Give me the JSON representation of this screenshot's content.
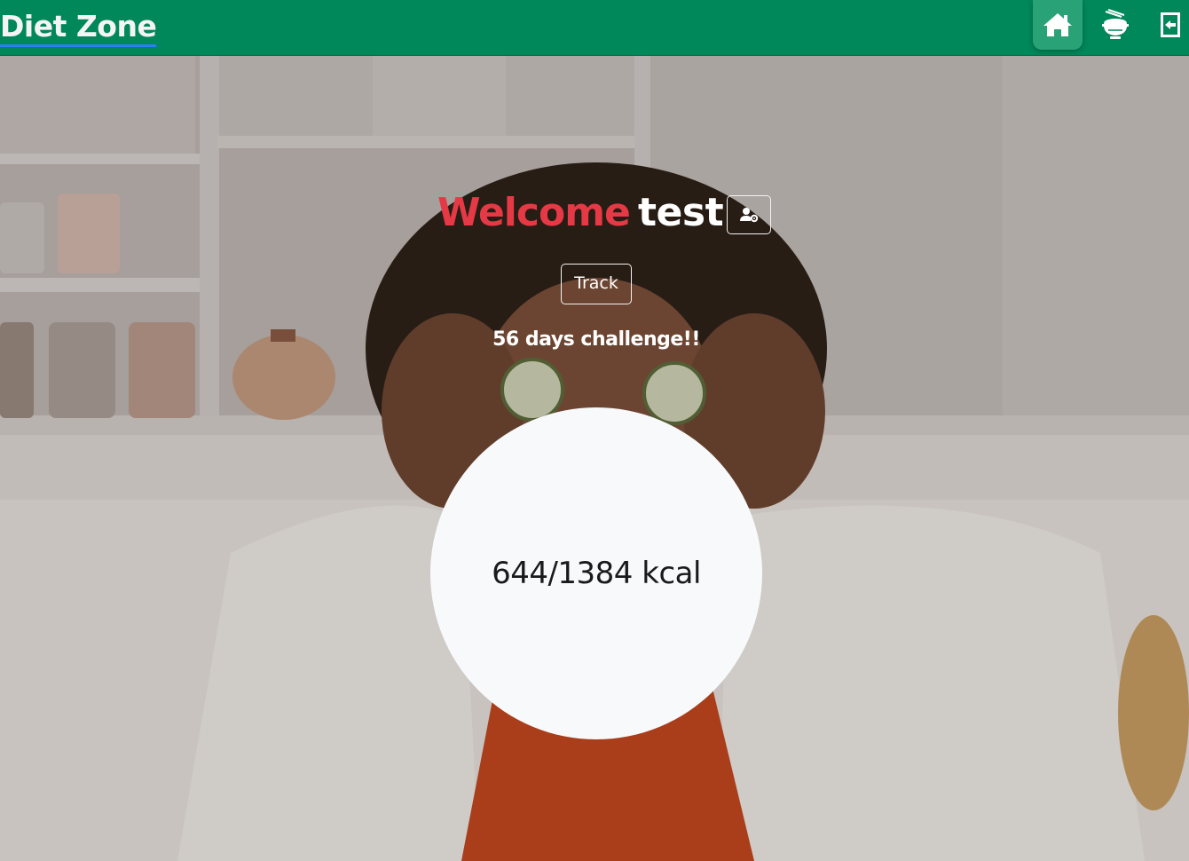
{
  "app": {
    "brand": "Diet Zone"
  },
  "nav": {
    "items": [
      {
        "icon": "home-icon",
        "active": true
      },
      {
        "icon": "food-bowl-icon",
        "active": false
      },
      {
        "icon": "logout-icon",
        "active": false
      }
    ]
  },
  "hero": {
    "welcome_word": "Welcome",
    "user_name": "test",
    "track_label": "Track",
    "challenge_text": "56 days challenge!!"
  },
  "calories": {
    "consumed": 644,
    "target": 1384,
    "display": "644/1384 kcal"
  },
  "colors": {
    "navbar": "#00875a",
    "nav_active": "#2aa277",
    "welcome": "#e53945",
    "circle": "#f8f9fa"
  }
}
